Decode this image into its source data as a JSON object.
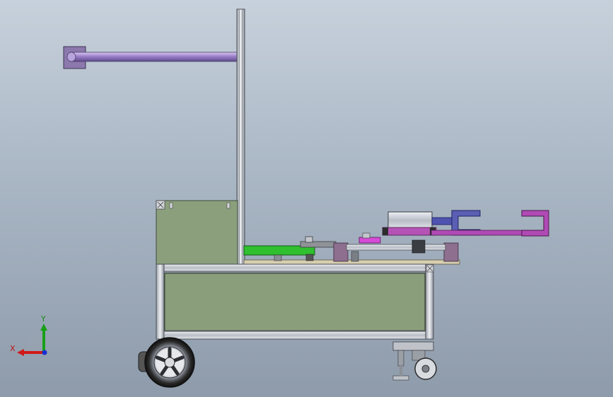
{
  "viewport": {
    "background_top": "#c7d1dc",
    "background_bottom": "#8e9bab"
  },
  "triad": {
    "x_label": "X",
    "y_label": "Y",
    "x_color": "#d01818",
    "y_color": "#18a018",
    "z_color": "#1830d0"
  },
  "colors": {
    "aluminum": "#c9ccd2",
    "panel": "#8a9e7c",
    "arm_purple": "#8a76b4",
    "gripper_blue": "#5a5fb4",
    "gripper_magenta": "#b04ab4",
    "green_part": "#2fbf2f",
    "wheel_dark": "#2a2a2a"
  }
}
